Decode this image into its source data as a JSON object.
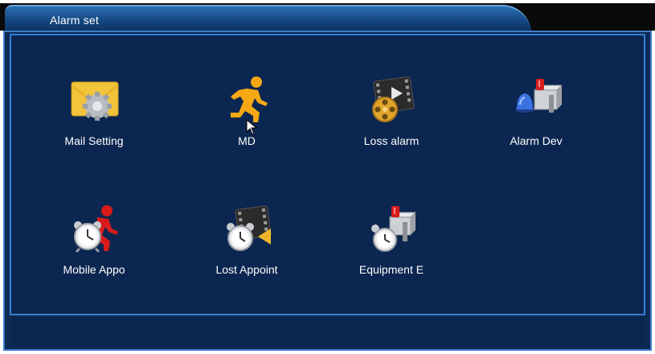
{
  "window": {
    "title": "Alarm set"
  },
  "items": [
    {
      "label": "Mail Setting",
      "icon": "mail-settings-icon"
    },
    {
      "label": "MD",
      "icon": "motion-detection-running-man-icon"
    },
    {
      "label": "Loss alarm",
      "icon": "video-loss-film-reel-icon"
    },
    {
      "label": "Alarm Dev",
      "icon": "alarm-device-siren-icon"
    },
    {
      "label": "Mobile Appo",
      "icon": "mobile-appointment-clock-icon"
    },
    {
      "label": "Lost Appoint",
      "icon": "lost-appointment-clock-icon"
    },
    {
      "label": "Equipment E",
      "icon": "equipment-exception-clock-icon"
    }
  ],
  "colors": {
    "panel_bg": "#0b2650",
    "border": "#3a7fd0",
    "title_bar": "#1a4f8f",
    "text": "#ffffff"
  }
}
